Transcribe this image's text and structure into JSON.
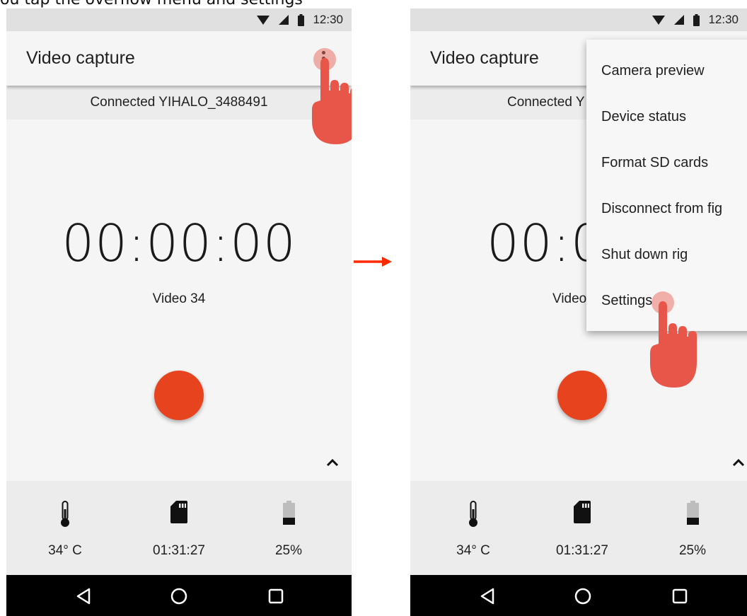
{
  "instruction": "ou tap the overflow menu and settings",
  "status_bar": {
    "time": "12:30"
  },
  "app_bar": {
    "title": "Video capture"
  },
  "connection": {
    "text": "Connected YIHALO_3488491",
    "text_truncated": "Connected Y"
  },
  "timer": {
    "value": "00:00:00",
    "value_truncated": "00:0"
  },
  "video": {
    "name": "Video 34",
    "name_truncated": "Video"
  },
  "stats": {
    "temperature": "34° C",
    "recording_time": "01:31:27",
    "battery": "25%"
  },
  "menu": {
    "items": [
      "Camera preview",
      "Device status",
      "Format SD cards",
      "Disconnect from fig",
      "Shut down rig",
      "Settings"
    ]
  },
  "colors": {
    "record": "#e8431f",
    "touch_hand": "#e8564a",
    "arrow": "#ff2a00"
  },
  "icons": [
    "wifi-icon",
    "signal-icon",
    "battery-icon",
    "overflow-menu-icon",
    "thermometer-icon",
    "sd-card-icon",
    "battery-level-icon",
    "chevron-up-icon",
    "back-icon",
    "home-icon",
    "recents-icon",
    "tap-hand-icon",
    "flow-arrow-icon"
  ]
}
